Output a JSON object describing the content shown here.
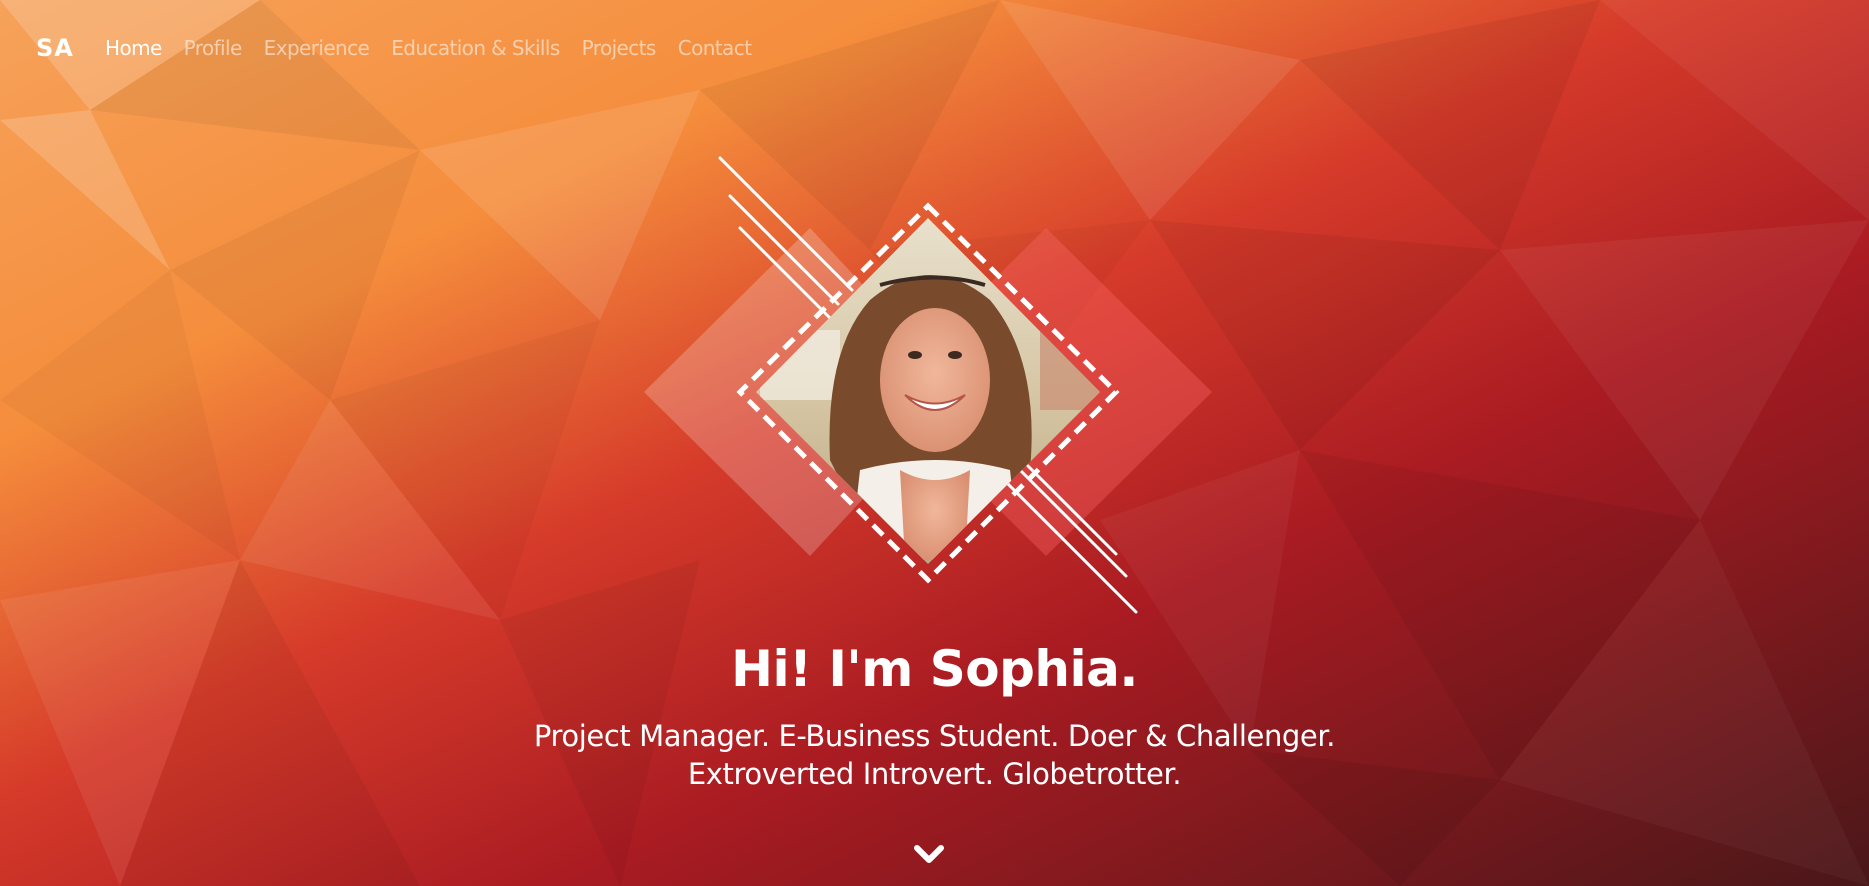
{
  "brand": {
    "logo": "SA"
  },
  "nav": {
    "items": [
      {
        "label": "Home",
        "active": true
      },
      {
        "label": "Profile",
        "active": false
      },
      {
        "label": "Experience",
        "active": false
      },
      {
        "label": "Education & Skills",
        "active": false
      },
      {
        "label": "Projects",
        "active": false
      },
      {
        "label": "Contact",
        "active": false
      }
    ]
  },
  "hero": {
    "title": "Hi! I'm Sophia.",
    "subtitle_line1": "Project Manager. E-Business Student. Doer & Challenger.",
    "subtitle_line2": "Extroverted Introvert. Globetrotter.",
    "scroll_icon": "chevron-down-icon"
  },
  "colors": {
    "orange": "#f7963f",
    "red": "#c0242a",
    "dark_red": "#4e1618",
    "text": "#ffffff"
  }
}
